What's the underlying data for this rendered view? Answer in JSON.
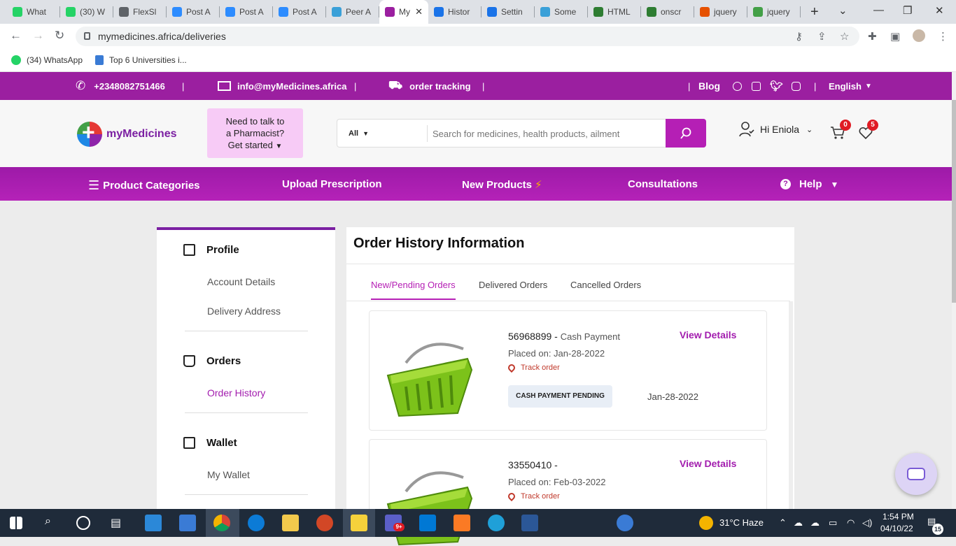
{
  "browser": {
    "tabs": [
      {
        "title": "What",
        "color": "#25d366"
      },
      {
        "title": "(30) W",
        "color": "#25d366"
      },
      {
        "title": "FlexSl",
        "color": "#5f6368"
      },
      {
        "title": "Post A",
        "color": "#2d8cff"
      },
      {
        "title": "Post A",
        "color": "#2d8cff"
      },
      {
        "title": "Post A",
        "color": "#2d8cff"
      },
      {
        "title": "Peer A",
        "color": "#3aa0d8"
      },
      {
        "title": "My",
        "color": "#9b1fa0"
      },
      {
        "title": "Histor",
        "color": "#1a73e8"
      },
      {
        "title": "Settin",
        "color": "#1a73e8"
      },
      {
        "title": "Some",
        "color": "#3aa0d8"
      },
      {
        "title": "HTML",
        "color": "#2e7d32"
      },
      {
        "title": "onscr",
        "color": "#2e7d32"
      },
      {
        "title": "jquery",
        "color": "#e65100"
      },
      {
        "title": "jquery",
        "color": "#43a047"
      }
    ],
    "active_tab_index": 7,
    "url": "mymedicines.africa/deliveries",
    "bookmarks": [
      {
        "label": "(34) WhatsApp"
      },
      {
        "label": "Top 6 Universities i..."
      }
    ]
  },
  "topbar": {
    "phone": "+2348082751466",
    "email": "info@myMedicines.africa",
    "tracking": "order tracking",
    "blog": "Blog",
    "language": "English"
  },
  "header": {
    "logo_text": "myMedicines",
    "pharmacist_line1": "Need to talk to",
    "pharmacist_line2": "a Pharmacist?",
    "pharmacist_cta": "Get started",
    "search_category": "All",
    "search_placeholder": "Search for medicines, health products, ailment",
    "greeting": "Hi Eniola",
    "cart_count": "0",
    "wishlist_count": "5"
  },
  "nav": {
    "categories": "Product Categories",
    "upload": "Upload Prescription",
    "new_products": "New Products",
    "consultations": "Consultations",
    "help": "Help"
  },
  "sidebar": {
    "profile": "Profile",
    "account_details": "Account Details",
    "delivery_address": "Delivery Address",
    "orders": "Orders",
    "order_history": "Order History",
    "wallet": "Wallet",
    "my_wallet": "My Wallet"
  },
  "panel": {
    "title": "Order History Information",
    "tabs": [
      "New/Pending Orders",
      "Delivered Orders",
      "Cancelled Orders"
    ],
    "view_details": "View Details",
    "track_order": "Track order",
    "orders": [
      {
        "number": "56968899 -",
        "payment": "Cash Payment",
        "placed": "Placed on: Jan-28-2022",
        "status": "CASH PAYMENT PENDING",
        "date": "Jan-28-2022"
      },
      {
        "number": "33550410 -",
        "payment": "",
        "placed": "Placed on: Feb-03-2022",
        "status": "",
        "date": ""
      }
    ]
  },
  "taskbar": {
    "weather": "31°C  Haze",
    "time": "1:54 PM",
    "date": "04/10/22",
    "notifications": "15",
    "teams_badge": "9+"
  }
}
